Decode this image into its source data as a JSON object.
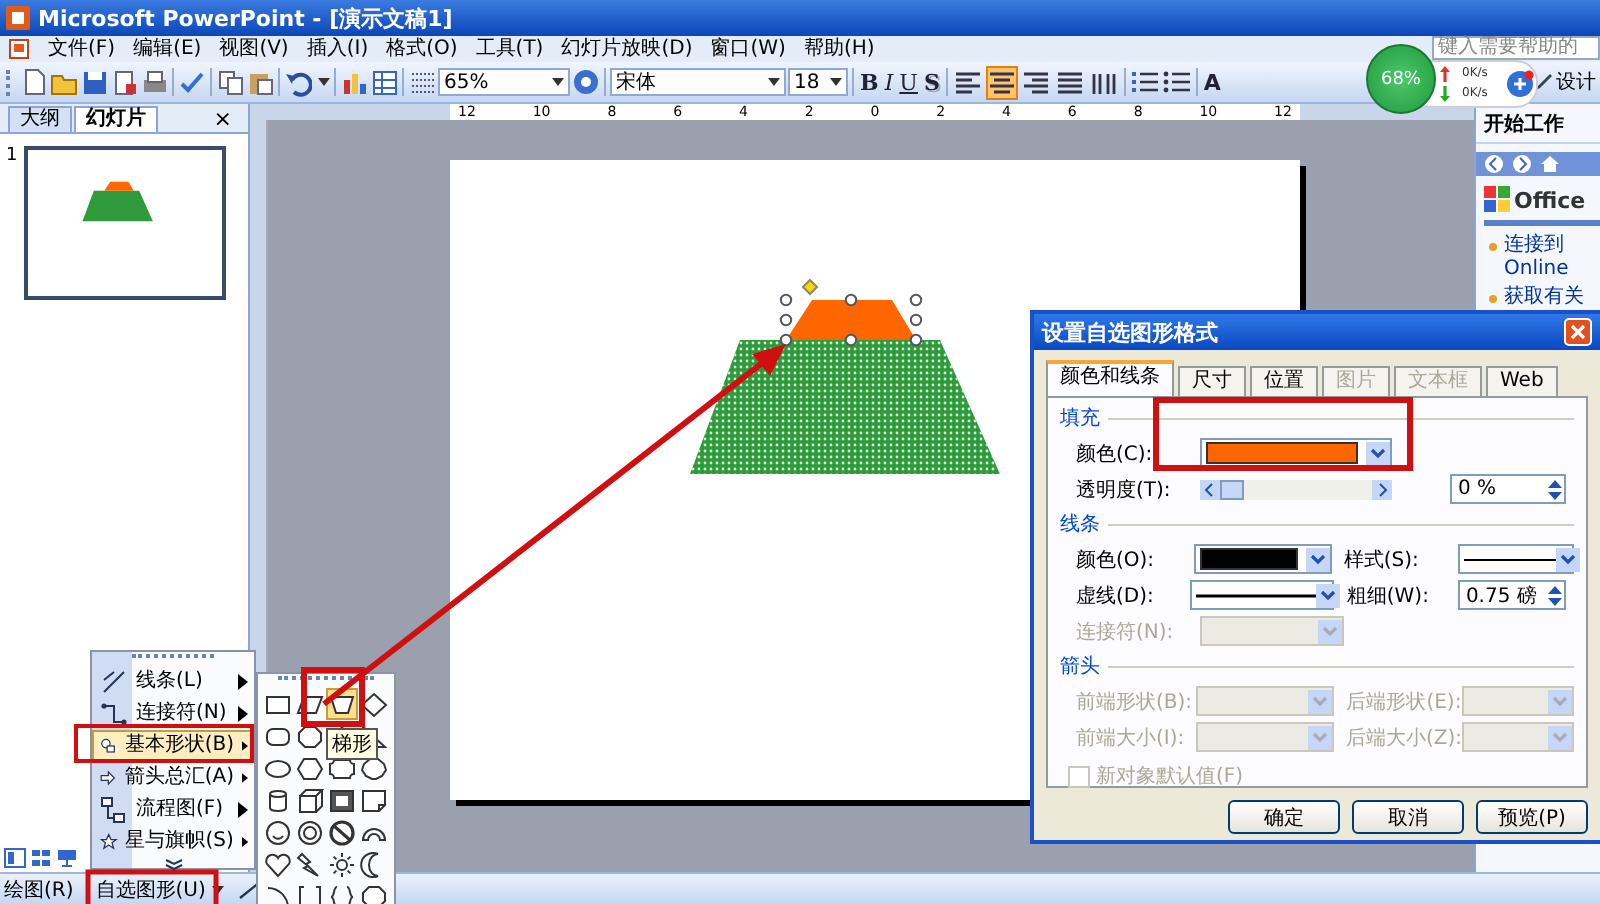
{
  "window": {
    "title": "Microsoft PowerPoint - [演示文稿1]"
  },
  "menu_bar": {
    "items": [
      "文件(F)",
      "编辑(E)",
      "视图(V)",
      "插入(I)",
      "格式(O)",
      "工具(T)",
      "幻灯片放映(D)",
      "窗口(W)",
      "帮助(H)"
    ],
    "help_placeholder": "键入需要帮助的"
  },
  "toolbar": {
    "zoom": "65%",
    "font": "宋体",
    "font_size": "18",
    "text_buttons": [
      {
        "label": "B",
        "kind": "bold"
      },
      {
        "label": "I",
        "kind": "italic"
      },
      {
        "label": "U",
        "kind": "underline"
      },
      {
        "label": "S",
        "kind": "shadow"
      }
    ],
    "align_buttons": [
      {
        "selected": false
      },
      {
        "selected": true
      },
      {
        "selected": false
      },
      {
        "selected": false
      },
      {
        "selected": false
      }
    ],
    "grow_font": "A",
    "design": "设计"
  },
  "net_monitor": {
    "percent": "68%",
    "upload": "0K/s",
    "download": "0K/s"
  },
  "slides_pane": {
    "tabs": [
      {
        "label": "大纲",
        "selected": false
      },
      {
        "label": "幻灯片",
        "selected": true
      }
    ],
    "close": "×",
    "slides": [
      {
        "number": "1",
        "selected": true
      }
    ]
  },
  "ruler": {
    "labels": [
      "12",
      "10",
      "8",
      "6",
      "4",
      "2",
      "0",
      "2",
      "4",
      "6",
      "8",
      "10",
      "12"
    ]
  },
  "slide": {
    "shapes": [
      {
        "kind": "base",
        "color": "#2e9a3c",
        "selected": false
      },
      {
        "kind": "cap",
        "color": "#ff6600",
        "selected": true
      }
    ]
  },
  "task_pane": {
    "title": "开始工作",
    "logo": "Office",
    "links": [
      "连接到 Online",
      "获取有关"
    ]
  },
  "dialog": {
    "title": "设置自选图形格式",
    "tabs": [
      {
        "label": "颜色和线条",
        "selected": true,
        "disabled": false
      },
      {
        "label": "尺寸",
        "selected": false,
        "disabled": false
      },
      {
        "label": "位置",
        "selected": false,
        "disabled": false
      },
      {
        "label": "图片",
        "selected": false,
        "disabled": true
      },
      {
        "label": "文本框",
        "selected": false,
        "disabled": true
      },
      {
        "label": "Web",
        "selected": false,
        "disabled": false
      }
    ],
    "fill": {
      "heading": "填充",
      "color_label": "颜色(C):",
      "color": "#ff6600",
      "transparency_label": "透明度(T):",
      "transparency": {
        "level": 0
      },
      "transparency_value": "0 %"
    },
    "line": {
      "heading": "线条",
      "color_label": "颜色(O):",
      "color": "#000000",
      "style_label": "样式(S):",
      "dash_label": "虚线(D):",
      "weight_label": "粗细(W):",
      "weight_value": "0.75 磅",
      "connector_label": "连接符(N):",
      "connector_disabled": true
    },
    "arrows": {
      "heading": "箭头",
      "fields": [
        {
          "label": "前端形状(B):",
          "disabled": true
        },
        {
          "label": "后端形状(E):",
          "disabled": true
        },
        {
          "label": "前端大小(I):",
          "disabled": true
        },
        {
          "label": "后端大小(Z):",
          "disabled": true
        }
      ]
    },
    "default_checkbox": {
      "label": "新对象默认值(F)",
      "checked": false,
      "disabled": true
    },
    "buttons": [
      {
        "label": "确定",
        "disabled": false
      },
      {
        "label": "取消",
        "disabled": false
      },
      {
        "label": "预览(P)",
        "disabled": false
      }
    ]
  },
  "autoshape_menu": {
    "items": [
      {
        "label": "线条(L)",
        "selected": false
      },
      {
        "label": "连接符(N)",
        "selected": false
      },
      {
        "label": "基本形状(B)",
        "selected": true
      },
      {
        "label": "箭头总汇(A)",
        "selected": false
      },
      {
        "label": "流程图(F)",
        "selected": false
      },
      {
        "label": "星与旗帜(S)",
        "selected": false
      }
    ]
  },
  "shape_palette": {
    "tooltip": "梯形",
    "shapes": [
      {
        "selected": false
      },
      {
        "selected": false
      },
      {
        "selected": true
      },
      {
        "selected": false
      },
      {
        "selected": false
      },
      {
        "selected": false
      },
      {
        "selected": false
      },
      {
        "selected": false
      },
      {
        "selected": false
      },
      {
        "selected": false
      },
      {
        "selected": false
      },
      {
        "selected": false
      },
      {
        "selected": false
      },
      {
        "selected": false
      },
      {
        "selected": false
      },
      {
        "selected": false
      },
      {
        "selected": false
      },
      {
        "selected": false
      },
      {
        "selected": false
      },
      {
        "selected": false
      },
      {
        "selected": false
      },
      {
        "selected": false
      },
      {
        "selected": false
      },
      {
        "selected": false
      },
      {
        "selected": false
      },
      {
        "selected": false
      },
      {
        "selected": false
      },
      {
        "selected": false
      }
    ]
  },
  "drawing_toolbar": {
    "draw": "绘图(R)",
    "autoshapes": "自选图形(U)"
  }
}
